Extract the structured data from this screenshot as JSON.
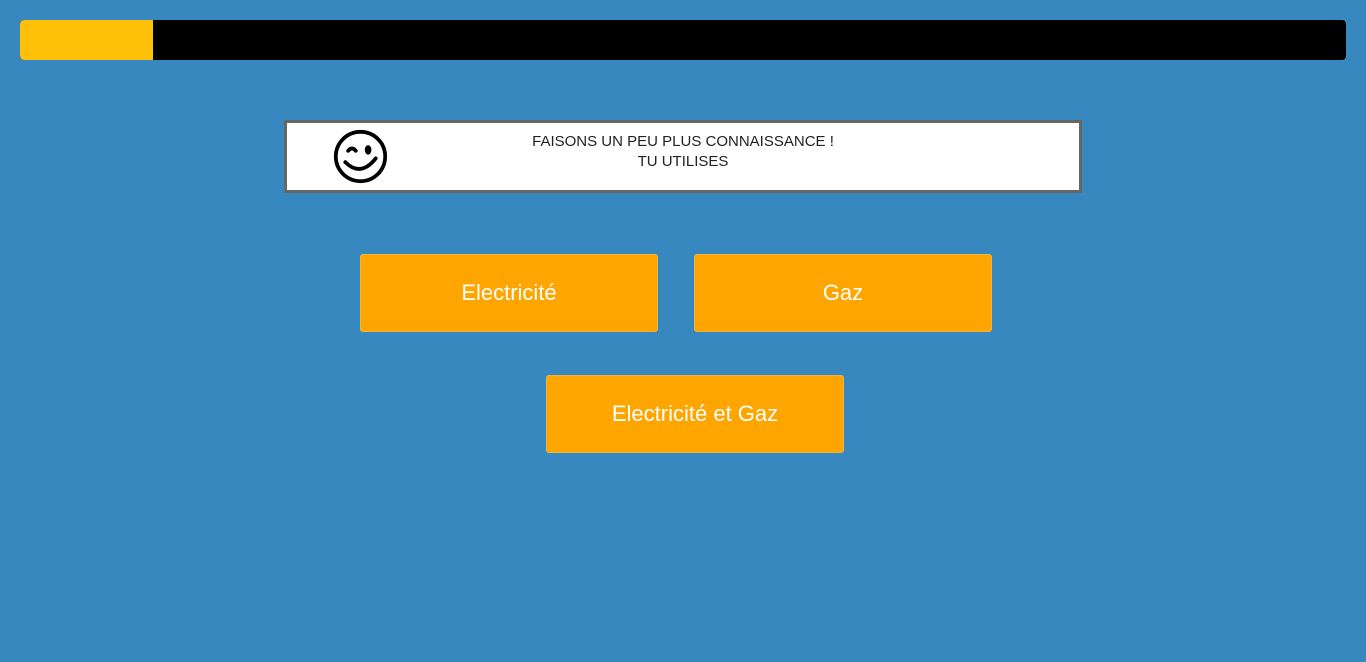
{
  "progress": {
    "percent": 10,
    "fill_color": "#ffc107",
    "track_color": "#000000"
  },
  "message": {
    "icon": "winking-smiley-icon",
    "line1": "FAISONS UN PEU PLUS CONNAISSANCE !",
    "line2": "TU UTILISES"
  },
  "choices": {
    "electricity": "Electricité",
    "gas": "Gaz",
    "both": "Electricité et Gaz"
  },
  "colors": {
    "background": "#3888c0",
    "button": "#ffa500",
    "button_text": "#ffffff"
  }
}
